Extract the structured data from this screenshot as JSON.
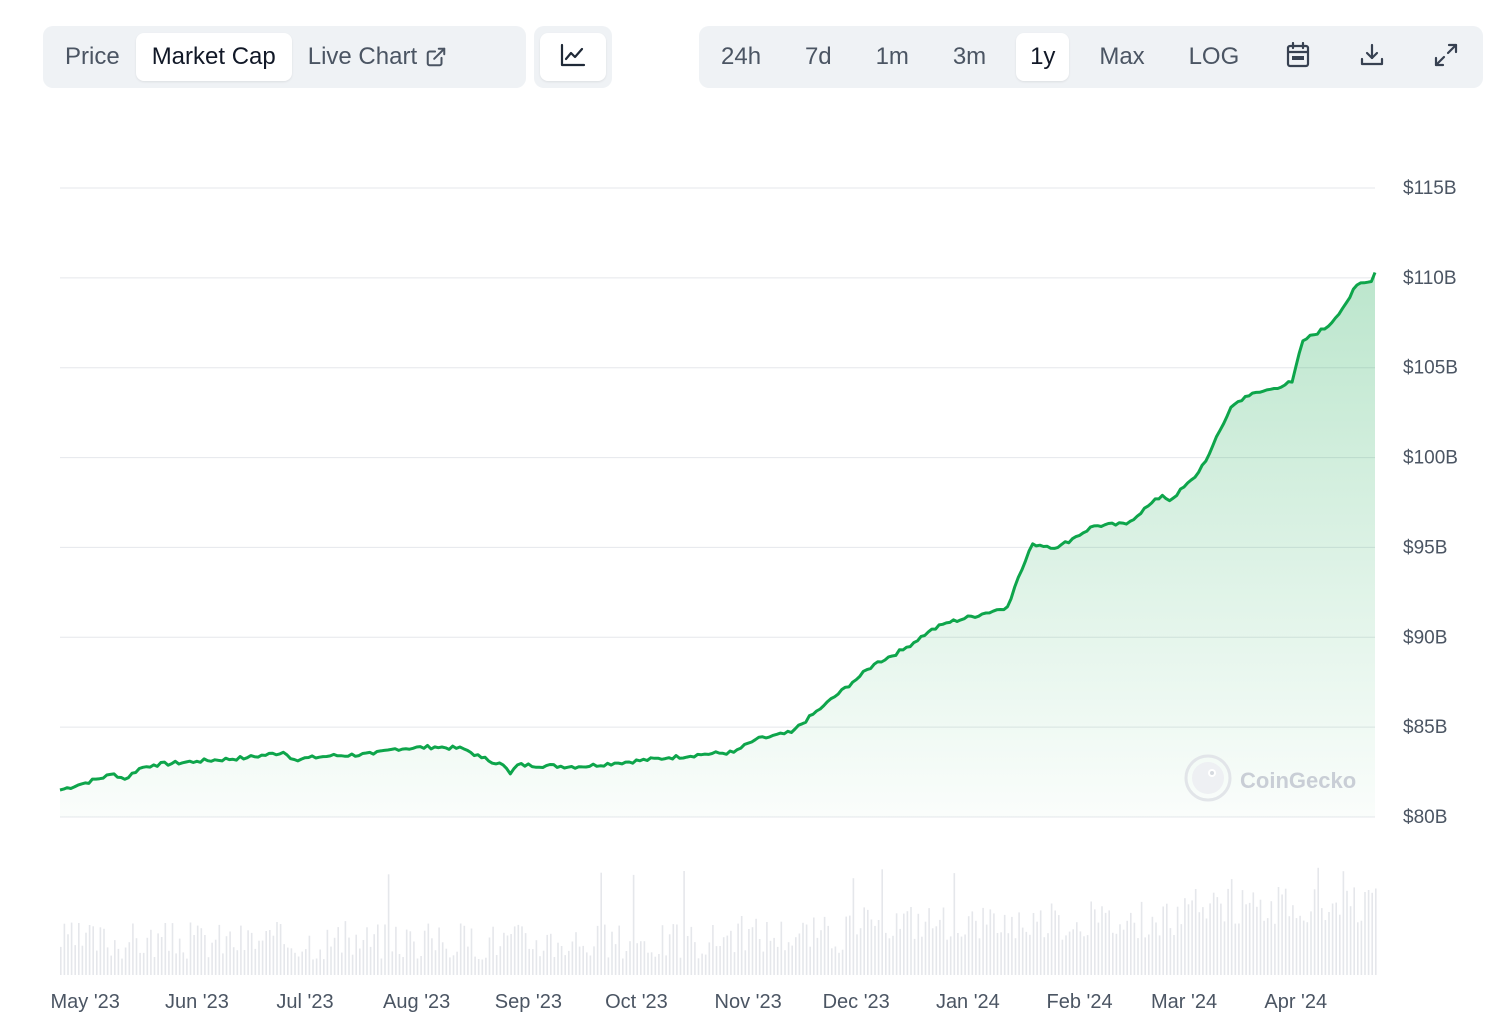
{
  "toolbar": {
    "left_tabs": [
      {
        "label": "Price",
        "active": false
      },
      {
        "label": "Market Cap",
        "active": true
      },
      {
        "label": "Live Chart",
        "active": false,
        "icon": "external-link-icon"
      }
    ],
    "chart_style_icon": "line-chart-icon",
    "ranges": [
      {
        "label": "24h",
        "active": false
      },
      {
        "label": "7d",
        "active": false
      },
      {
        "label": "1m",
        "active": false
      },
      {
        "label": "3m",
        "active": false
      },
      {
        "label": "1y",
        "active": true
      },
      {
        "label": "Max",
        "active": false
      },
      {
        "label": "LOG",
        "active": false
      }
    ],
    "right_icons": [
      "calendar-icon",
      "download-icon",
      "fullscreen-icon"
    ]
  },
  "watermark": {
    "label": "CoinGecko",
    "icon": "gecko-logo-icon"
  },
  "colors": {
    "line": "#0ea54b",
    "fill_top": "#0ea54b",
    "grid": "#e5e7eb",
    "volume": "#e5e7eb"
  },
  "chart_data": {
    "type": "area",
    "title": "",
    "xlabel": "",
    "ylabel": "",
    "grid": true,
    "ylim": [
      80,
      115
    ],
    "y_ticks": [
      {
        "value": 115,
        "label": "$115B"
      },
      {
        "value": 110,
        "label": "$110B"
      },
      {
        "value": 105,
        "label": "$105B"
      },
      {
        "value": 100,
        "label": "$100B"
      },
      {
        "value": 95,
        "label": "$95B"
      },
      {
        "value": 90,
        "label": "$90B"
      },
      {
        "value": 85,
        "label": "$85B"
      },
      {
        "value": 80,
        "label": "$80B"
      }
    ],
    "x_range": [
      "2023-04-24",
      "2024-04-23"
    ],
    "x_ticks": [
      {
        "date": "2023-05-01",
        "label": "May '23"
      },
      {
        "date": "2023-06-01",
        "label": "Jun '23"
      },
      {
        "date": "2023-07-01",
        "label": "Jul '23"
      },
      {
        "date": "2023-08-01",
        "label": "Aug '23"
      },
      {
        "date": "2023-09-01",
        "label": "Sep '23"
      },
      {
        "date": "2023-10-01",
        "label": "Oct '23"
      },
      {
        "date": "2023-11-01",
        "label": "Nov '23"
      },
      {
        "date": "2023-12-01",
        "label": "Dec '23"
      },
      {
        "date": "2024-01-01",
        "label": "Jan '24"
      },
      {
        "date": "2024-02-01",
        "label": "Feb '24"
      },
      {
        "date": "2024-03-01",
        "label": "Mar '24"
      },
      {
        "date": "2024-04-01",
        "label": "Apr '24"
      }
    ],
    "series": [
      {
        "values": [
          [
            "2023-04-24",
            81.5
          ],
          [
            "2023-05-01",
            81.9
          ],
          [
            "2023-05-09",
            82.4
          ],
          [
            "2023-05-12",
            82.1
          ],
          [
            "2023-05-16",
            82.7
          ],
          [
            "2023-05-20",
            82.9
          ],
          [
            "2023-06-01",
            83.1
          ],
          [
            "2023-06-15",
            83.3
          ],
          [
            "2023-06-25",
            83.6
          ],
          [
            "2023-06-28",
            83.2
          ],
          [
            "2023-07-08",
            83.4
          ],
          [
            "2023-07-20",
            83.5
          ],
          [
            "2023-07-26",
            83.8
          ],
          [
            "2023-08-06",
            83.9
          ],
          [
            "2023-08-14",
            83.8
          ],
          [
            "2023-08-19",
            83.3
          ],
          [
            "2023-08-25",
            82.9
          ],
          [
            "2023-08-27",
            82.4
          ],
          [
            "2023-08-29",
            82.9
          ],
          [
            "2023-09-15",
            82.8
          ],
          [
            "2023-09-25",
            83.0
          ],
          [
            "2023-10-10",
            83.3
          ],
          [
            "2023-10-20",
            83.5
          ],
          [
            "2023-10-28",
            83.6
          ],
          [
            "2023-11-03",
            84.3
          ],
          [
            "2023-11-13",
            84.7
          ],
          [
            "2023-11-22",
            86.2
          ],
          [
            "2023-11-30",
            87.5
          ],
          [
            "2023-12-06",
            88.5
          ],
          [
            "2023-12-14",
            89.3
          ],
          [
            "2023-12-21",
            90.3
          ],
          [
            "2023-12-26",
            90.8
          ],
          [
            "2024-01-05",
            91.3
          ],
          [
            "2024-01-12",
            91.7
          ],
          [
            "2024-01-14",
            92.8
          ],
          [
            "2024-01-19",
            95.2
          ],
          [
            "2024-01-26",
            95.0
          ],
          [
            "2024-01-31",
            95.6
          ],
          [
            "2024-02-05",
            96.2
          ],
          [
            "2024-02-14",
            96.3
          ],
          [
            "2024-02-20",
            97.3
          ],
          [
            "2024-02-24",
            97.9
          ],
          [
            "2024-02-26",
            97.6
          ],
          [
            "2024-03-04",
            98.9
          ],
          [
            "2024-03-08",
            100.2
          ],
          [
            "2024-03-14",
            102.8
          ],
          [
            "2024-03-18",
            103.4
          ],
          [
            "2024-03-25",
            103.8
          ],
          [
            "2024-03-31",
            104.2
          ],
          [
            "2024-04-03",
            106.5
          ],
          [
            "2024-04-10",
            107.3
          ],
          [
            "2024-04-15",
            108.6
          ],
          [
            "2024-04-18",
            109.6
          ],
          [
            "2024-04-22",
            109.8
          ],
          [
            "2024-04-23",
            110.3
          ]
        ]
      }
    ]
  }
}
